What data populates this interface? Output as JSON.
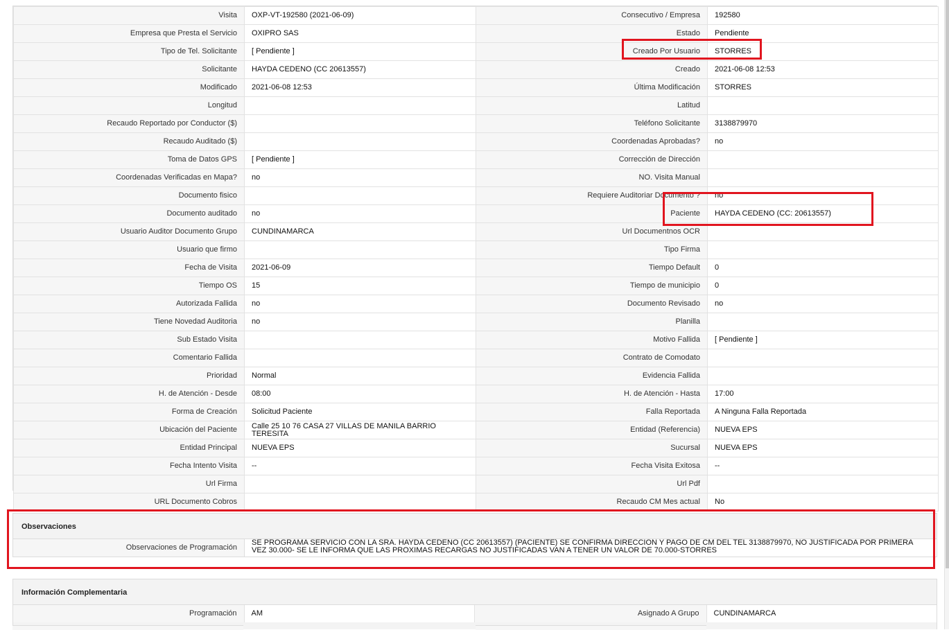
{
  "details": {
    "rows": [
      {
        "l1": "Visita",
        "v1": "OXP-VT-192580 (2021-06-09)",
        "l2": "Consecutivo / Empresa",
        "v2": "192580"
      },
      {
        "l1": "Empresa que Presta el Servicio",
        "v1": "OXIPRO SAS",
        "l2": "Estado",
        "v2": "Pendiente"
      },
      {
        "l1": "Tipo de Tel. Solicitante",
        "v1": "[ Pendiente ]",
        "l2": "Creado Por Usuario",
        "v2": "STORRES"
      },
      {
        "l1": "Solicitante",
        "v1": "HAYDA CEDENO (CC 20613557)",
        "l2": "Creado",
        "v2": "2021-06-08 12:53"
      },
      {
        "l1": "Modificado",
        "v1": "2021-06-08 12:53",
        "l2": "Última Modificación",
        "v2": " STORRES"
      },
      {
        "l1": "Longitud",
        "v1": "",
        "l2": "Latitud",
        "v2": ""
      },
      {
        "l1": "Recaudo Reportado por Conductor ($)",
        "v1": "",
        "l2": "Teléfono Solicitante",
        "v2": "3138879970"
      },
      {
        "l1": "Recaudo Auditado ($)",
        "v1": "",
        "l2": "Coordenadas Aprobadas?",
        "v2": " no"
      },
      {
        "l1": "Toma de Datos GPS",
        "v1": "[ Pendiente ]",
        "l2": "Corrección de Dirección",
        "v2": ""
      },
      {
        "l1": "Coordenadas Verificadas en Mapa?",
        "v1": " no",
        "l2": "NO. Visita Manual",
        "v2": ""
      },
      {
        "l1": "Documento fisico",
        "v1": "",
        "l2": "Requiere Auditoriar Documento ?",
        "v2": " no"
      },
      {
        "l1": "Documento auditado",
        "v1": " no",
        "l2": "Paciente",
        "v2": "HAYDA CEDENO (CC: 20613557)"
      },
      {
        "l1": "Usuario Auditor Documento Grupo",
        "v1": "CUNDINAMARCA",
        "l2": "Url Documentnos OCR",
        "v2": ""
      },
      {
        "l1": "Usuario que firmo",
        "v1": "",
        "l2": "Tipo Firma",
        "v2": ""
      },
      {
        "l1": "Fecha de Visita",
        "v1": " 2021-06-09",
        "l2": "Tiempo Default",
        "v2": " 0"
      },
      {
        "l1": "Tiempo OS",
        "v1": " 15",
        "l2": "Tiempo de municipio",
        "v2": " 0"
      },
      {
        "l1": "Autorizada Fallida",
        "v1": " no",
        "l2": "Documento Revisado",
        "v2": " no"
      },
      {
        "l1": "Tiene Novedad Auditoria",
        "v1": " no",
        "l2": "Planilla",
        "v2": ""
      },
      {
        "l1": "Sub Estado Visita",
        "v1": "",
        "l2": "Motivo Fallida",
        "v2": "[ Pendiente ]"
      },
      {
        "l1": "Comentario Fallida",
        "v1": "",
        "l2": "Contrato de Comodato",
        "v2": ""
      },
      {
        "l1": "Prioridad",
        "v1": "Normal",
        "l2": "Evidencia Fallida",
        "v2": ""
      },
      {
        "l1": "H. de Atención - Desde",
        "v1": "08:00",
        "l2": "H. de Atención - Hasta",
        "v2": "17:00"
      },
      {
        "l1": "Forma de Creación",
        "v1": "Solicitud Paciente",
        "l2": "Falla Reportada",
        "v2": "A Ninguna Falla Reportada"
      },
      {
        "l1": "Ubicación del Paciente",
        "v1": "Calle 25 10 76 CASA 27 VILLAS DE MANILA BARRIO TERESITA",
        "l2": "Entidad (Referencia)",
        "v2": "NUEVA EPS"
      },
      {
        "l1": "Entidad Principal",
        "v1": "NUEVA EPS",
        "l2": "Sucursal",
        "v2": "NUEVA EPS"
      },
      {
        "l1": "Fecha Intento Visita",
        "v1": " --",
        "l2": "Fecha Visita Exitosa",
        "v2": " --"
      },
      {
        "l1": "Url Firma",
        "v1": "",
        "l2": "Url Pdf",
        "v2": ""
      },
      {
        "l1": "URL Documento Cobros",
        "v1": "",
        "l2": "Recaudo CM Mes actual",
        "v2": "No"
      }
    ]
  },
  "observaciones": {
    "title": "Observaciones",
    "label": "Observaciones de Programación",
    "value": "  SE PROGRAMA SERVICIO CON LA SRA. HAYDA CEDENO (CC 20613557) (PACIENTE) SE CONFIRMA DIRECCION Y PAGO DE CM DEL TEL 3138879970, NO JUSTIFICADA POR PRIMERA VEZ 30.000- SE LE INFORMA QUE LAS PROXIMAS RECARGAS NO JUSTIFICADAS VAN A TENER UN VALOR DE 70.000-STORRES"
  },
  "info_complementaria": {
    "title": "Información Complementaria",
    "programacion_label": "Programación",
    "programacion_value": "AM",
    "asignado_label": "Asignado A Grupo",
    "asignado_value": "CUNDINAMARCA"
  },
  "colors": {
    "highlight": "#e1151f",
    "label_bg": "#f6f6f6",
    "border": "#e2e2e2"
  }
}
